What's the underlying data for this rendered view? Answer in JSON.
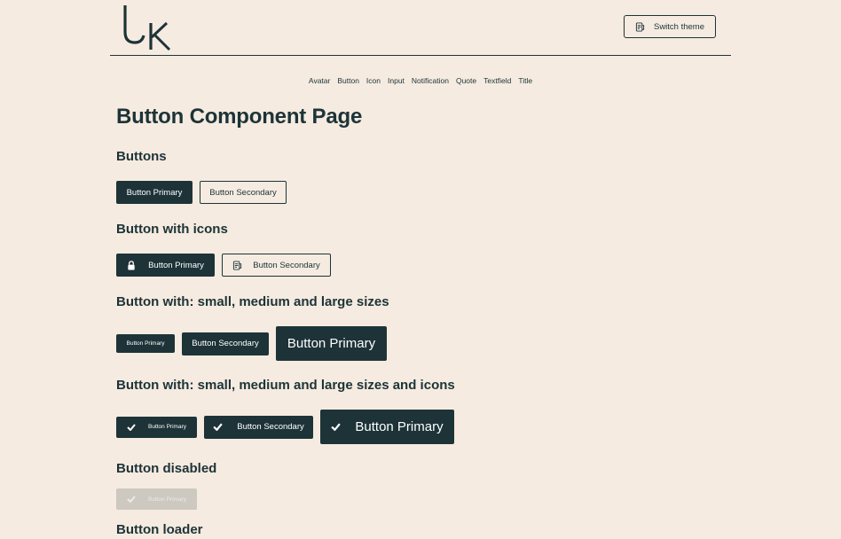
{
  "header": {
    "logo_alt": "UK",
    "theme_button_label": "Switch theme"
  },
  "nav": {
    "items": [
      "Avatar",
      "Button",
      "Icon",
      "Input",
      "Notification",
      "Quote",
      "Textfield",
      "Title"
    ]
  },
  "page": {
    "title": "Button Component Page"
  },
  "sections": {
    "buttons": {
      "title": "Buttons",
      "primary": "Button Primary",
      "secondary": "Button Secondary"
    },
    "icons": {
      "title": "Button with icons",
      "primary": "Button Primary",
      "secondary": "Button Secondary",
      "primary_icon": "lock-icon",
      "secondary_icon": "theme-icon"
    },
    "sizes": {
      "title": "Button with: small, medium and large sizes",
      "small": "Button Primary",
      "medium": "Button Secondary",
      "large": "Button Primary"
    },
    "sizes_icons": {
      "title": "Button with: small, medium and large sizes and icons",
      "small": "Button Primary",
      "medium": "Button Secondary",
      "large": "Button Primary",
      "icon": "check-icon"
    },
    "disabled": {
      "title": "Button disabled",
      "label": "Button Primary",
      "icon": "check-icon"
    },
    "loader": {
      "title": "Button loader"
    }
  },
  "colors": {
    "background": "#f5ebe0",
    "primary": "#1d3338",
    "disabled": "#cdc8c0"
  }
}
